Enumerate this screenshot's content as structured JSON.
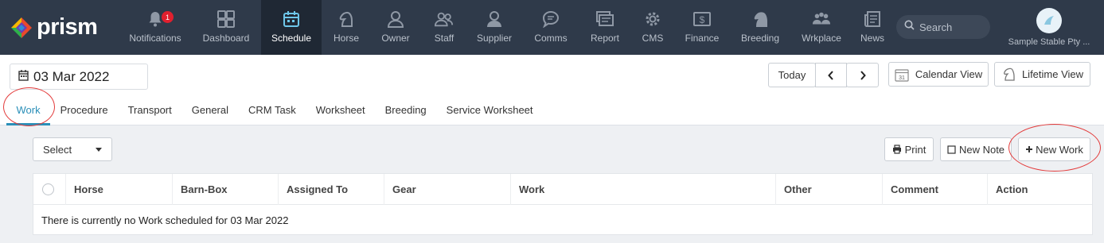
{
  "brand": {
    "name": "prism"
  },
  "nav": [
    {
      "label": "Notifications",
      "icon": "bell-icon",
      "badge": "1"
    },
    {
      "label": "Dashboard",
      "icon": "dashboard-icon"
    },
    {
      "label": "Schedule",
      "icon": "calendar-icon",
      "active": true
    },
    {
      "label": "Horse",
      "icon": "horse-icon"
    },
    {
      "label": "Owner",
      "icon": "person-icon"
    },
    {
      "label": "Staff",
      "icon": "people-icon"
    },
    {
      "label": "Supplier",
      "icon": "supplier-icon"
    },
    {
      "label": "Comms",
      "icon": "chat-icon"
    },
    {
      "label": "Report",
      "icon": "report-icon"
    },
    {
      "label": "CMS",
      "icon": "gear-icon"
    },
    {
      "label": "Finance",
      "icon": "finance-icon"
    },
    {
      "label": "Breeding",
      "icon": "breeding-icon"
    },
    {
      "label": "Wrkplace",
      "icon": "workplace-icon"
    },
    {
      "label": "News",
      "icon": "news-icon"
    }
  ],
  "search": {
    "placeholder": "Search"
  },
  "account": {
    "name": "Sample Stable Pty ..."
  },
  "date": {
    "value": "03 Mar 2022"
  },
  "controls": {
    "today": "Today",
    "calendar_view": "Calendar View",
    "lifetime_view": "Lifetime View"
  },
  "tabs": [
    {
      "label": "Work",
      "active": true
    },
    {
      "label": "Procedure"
    },
    {
      "label": "Transport"
    },
    {
      "label": "General"
    },
    {
      "label": "CRM Task"
    },
    {
      "label": "Worksheet"
    },
    {
      "label": "Breeding"
    },
    {
      "label": "Service Worksheet"
    }
  ],
  "toolbar": {
    "select": "Select",
    "print": "Print",
    "new_note": "New Note",
    "new_work": "New Work"
  },
  "table": {
    "columns": [
      "Horse",
      "Barn-Box",
      "Assigned To",
      "Gear",
      "Work",
      "Other",
      "Comment",
      "Action"
    ],
    "empty_message": "There is currently no Work scheduled for 03 Mar 2022"
  },
  "colors": {
    "nav_bg": "#2f3a4a",
    "nav_active_bg": "#1f2834",
    "accent": "#2a8fb8",
    "badge": "#e0202e",
    "highlight": "#e33b3b"
  }
}
